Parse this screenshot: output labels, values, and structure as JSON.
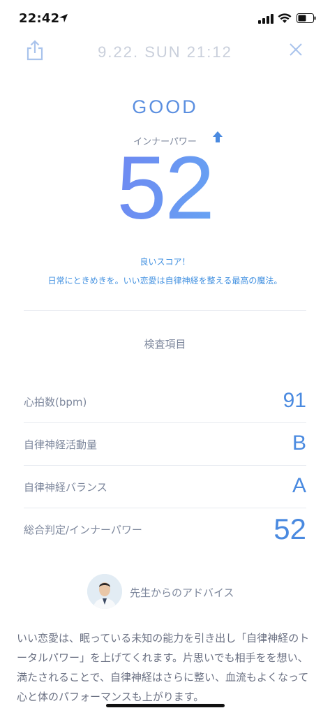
{
  "status_bar": {
    "time": "22:42"
  },
  "header": {
    "datetime": "9.22. SUN 21:12"
  },
  "result": {
    "status_word": "GOOD",
    "inner_power_label": "インナーパワー",
    "score": "52",
    "message": "良いスコア！",
    "description": "日常にときめきを。いい恋愛は自律神経を整える最高の魔法。"
  },
  "section_title": "検査項目",
  "items": [
    {
      "label": "心拍数(bpm)",
      "value": "91"
    },
    {
      "label": "自律神経活動量",
      "value": "B"
    },
    {
      "label": "自律神経バランス",
      "value": "A"
    },
    {
      "label": "総合判定/インナーパワー",
      "value": "52"
    }
  ],
  "advisor": {
    "label": "先生からのアドバイス"
  },
  "advice_text": "いい恋愛は、眠っている未知の能力を引き出し「自律神経のトータルパワー」を上げてくれます。片思いでも相手をを想い、満たされることで、自律神経はさらに整い、血流もよくなって心と体のパフォーマンスも上がります。",
  "colors": {
    "accent": "#5b8fe0",
    "value_blue": "#4a8ae0",
    "text_gray": "#7d879c",
    "light_gray": "#c9cfdb"
  }
}
